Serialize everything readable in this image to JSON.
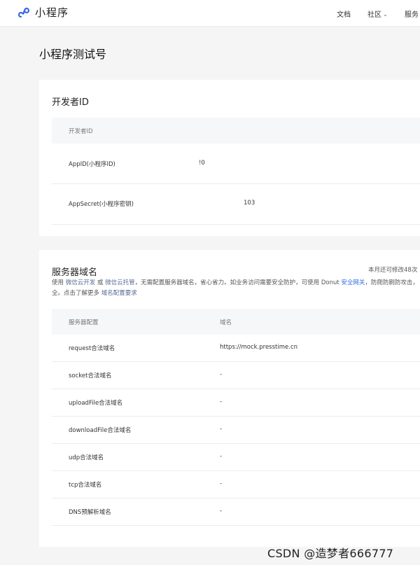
{
  "header": {
    "brand": "小程序",
    "nav": {
      "docs": "文档",
      "community": "社区",
      "services": "服务"
    }
  },
  "page_title": "小程序测试号",
  "developer_card": {
    "title": "开发者ID",
    "table_header": "开发者ID",
    "rows": [
      {
        "label": "AppID(小程序ID)",
        "value": "!0"
      },
      {
        "label": "AppSecret(小程序密钥)",
        "value": "103"
      }
    ]
  },
  "server_card": {
    "title": "服务器域名",
    "remaining": "本月还可修改48次",
    "desc": {
      "p1": "使用 ",
      "link_dev": "微信云开发",
      "p2": " 或 ",
      "link_host": "微信云托管",
      "p3": "，无需配置服务器域名，省心省力。如业务访问需要安全防护，可使用 Donut ",
      "link_gateway": "安全网关",
      "p4": "，防爬防刷防攻击，",
      "p5": "全。点击了解更多 ",
      "link_req": "域名配置要求"
    },
    "columns": {
      "config": "服务器配置",
      "domain": "域名"
    },
    "rows": [
      {
        "label": "request合法域名",
        "value": "https://mock.presstime.cn"
      },
      {
        "label": "socket合法域名",
        "value": "-"
      },
      {
        "label": "uploadFile合法域名",
        "value": "-"
      },
      {
        "label": "downloadFile合法域名",
        "value": "-"
      },
      {
        "label": "udp合法域名",
        "value": "-"
      },
      {
        "label": "tcp合法域名",
        "value": "-"
      },
      {
        "label": "DNS预解析域名",
        "value": "-"
      }
    ]
  },
  "watermark": "CSDN @造梦者666777"
}
